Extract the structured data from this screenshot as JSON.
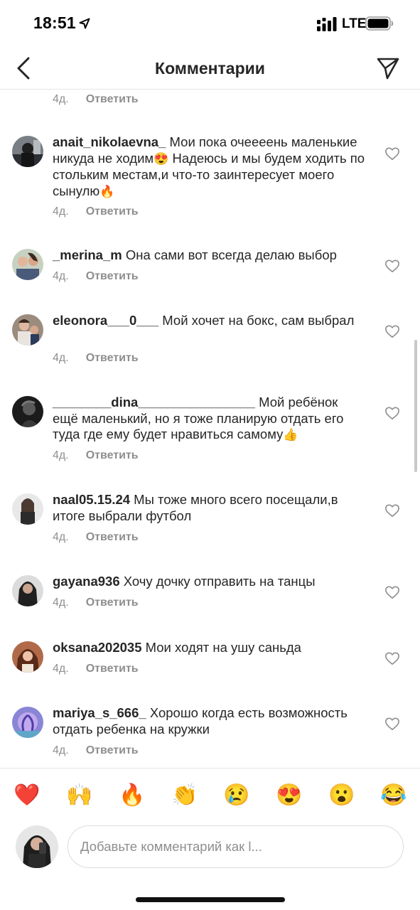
{
  "status_bar": {
    "time": "18:51",
    "network": "LTE",
    "icons": [
      "location-arrow-icon",
      "signal-icon",
      "battery-icon"
    ]
  },
  "header": {
    "title": "Комментарии",
    "back_icon": "chevron-left-icon",
    "share_icon": "paper-plane-icon"
  },
  "top_partial": {
    "time": "4д.",
    "reply_label": "Ответить"
  },
  "comments": [
    {
      "username": "anait_nikolaevna_",
      "text_parts": [
        "Мои пока очеееень маленькие никуда не ходим",
        "😍",
        " Надеюсь и мы будем ходить по стольким местам,и что-то заинтересует моего сынулю",
        "🔥"
      ],
      "time": "4д.",
      "reply_label": "Ответить"
    },
    {
      "username": "_merina_m",
      "text_parts": [
        "Она сами вот всегда делаю выбор"
      ],
      "time": "4д.",
      "reply_label": "Ответить"
    },
    {
      "username": "eleonora___0___",
      "text_parts": [
        "Мой хочет на бокс, сам выбрал"
      ],
      "time": "4д.",
      "reply_label": "Ответить"
    },
    {
      "username": "________dina________________",
      "text_parts": [
        "Мой ребёнок ещё маленький, но я тоже планирую отдать его туда где ему будет нравиться самому",
        "👍"
      ],
      "time": "4д.",
      "reply_label": "Ответить"
    },
    {
      "username": "naal05.15.24",
      "text_parts": [
        "Мы тоже много всего посещали,в итоге выбрали футбол"
      ],
      "time": "4д.",
      "reply_label": "Ответить"
    },
    {
      "username": "gayana936",
      "text_parts": [
        "Хочу дочку отправить на танцы"
      ],
      "time": "4д.",
      "reply_label": "Ответить"
    },
    {
      "username": "oksana202035",
      "text_parts": [
        "Мои ходят на ушу саньда"
      ],
      "time": "4д.",
      "reply_label": "Ответить"
    },
    {
      "username": "mariya_s_666_",
      "text_parts": [
        "Хорошо когда есть возможность отдать ребенка на кружки"
      ],
      "time": "4д.",
      "reply_label": "Ответить"
    }
  ],
  "reactions": [
    "❤️",
    "🙌",
    "🔥",
    "👏",
    "😢",
    "😍",
    "😮",
    "😂"
  ],
  "composer": {
    "placeholder": "Добавьте комментарий как l..."
  },
  "colors": {
    "text": "#262626",
    "secondary": "#8e8e8e",
    "divider": "#e6e6e6",
    "like_outline": "#8e8e8e"
  }
}
